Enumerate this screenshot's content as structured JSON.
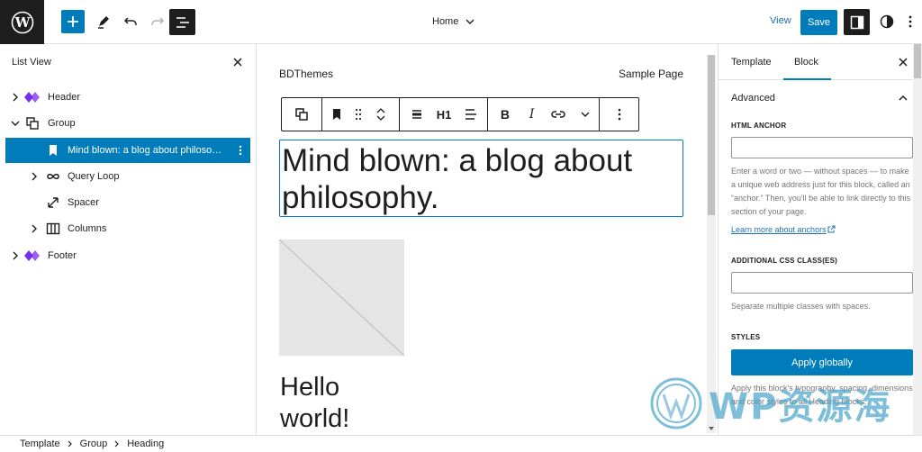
{
  "topbar": {
    "document_title": "Home",
    "view_label": "View",
    "save_label": "Save"
  },
  "list_view": {
    "title": "List View",
    "items": [
      {
        "label": "Header",
        "icon": "template-part-icon",
        "expandable": true,
        "expanded": false,
        "level": 0
      },
      {
        "label": "Group",
        "icon": "group-icon",
        "expandable": true,
        "expanded": true,
        "level": 0
      },
      {
        "label": "Mind blown: a blog about philosop...",
        "icon": "bookmark-icon",
        "expandable": false,
        "selected": true,
        "level": 1
      },
      {
        "label": "Query Loop",
        "icon": "loop-icon",
        "expandable": true,
        "expanded": false,
        "level": 1
      },
      {
        "label": "Spacer",
        "icon": "resize-icon",
        "expandable": false,
        "level": 1
      },
      {
        "label": "Columns",
        "icon": "columns-icon",
        "expandable": true,
        "expanded": false,
        "level": 1
      },
      {
        "label": "Footer",
        "icon": "template-part-icon",
        "expandable": true,
        "expanded": false,
        "level": 0
      }
    ]
  },
  "canvas": {
    "site_title": "BDThemes",
    "nav_link": "Sample Page",
    "heading_level": "H1",
    "heading_text": "Mind blown: a blog about philosophy.",
    "post_title_line1": "Hello",
    "post_title_line2": "world!"
  },
  "sidebar": {
    "tabs": [
      "Template",
      "Block"
    ],
    "active_tab": "Block",
    "advanced_label": "Advanced",
    "html_anchor_label": "HTML ANCHOR",
    "html_anchor_value": "",
    "html_anchor_help": "Enter a word or two — without spaces — to make a unique web address just for this block, called an “anchor.” Then, you'll be able to link directly to this section of your page.",
    "learn_more": "Learn more about anchors",
    "css_class_label": "ADDITIONAL CSS CLASS(ES)",
    "css_class_value": "",
    "css_class_help": "Separate multiple classes with spaces.",
    "styles_label": "STYLES",
    "apply_globally": "Apply globally",
    "styles_help": "Apply this block's typography, spacing, dimensions, and color styles to all Heading blocks."
  },
  "breadcrumb": [
    "Template",
    "Group",
    "Heading"
  ],
  "watermark": "WP资源海",
  "colors": {
    "accent": "#007cba",
    "dark": "#1e1e1e",
    "border": "#e0e0e0",
    "purple_icon": "#7b2cf0"
  }
}
